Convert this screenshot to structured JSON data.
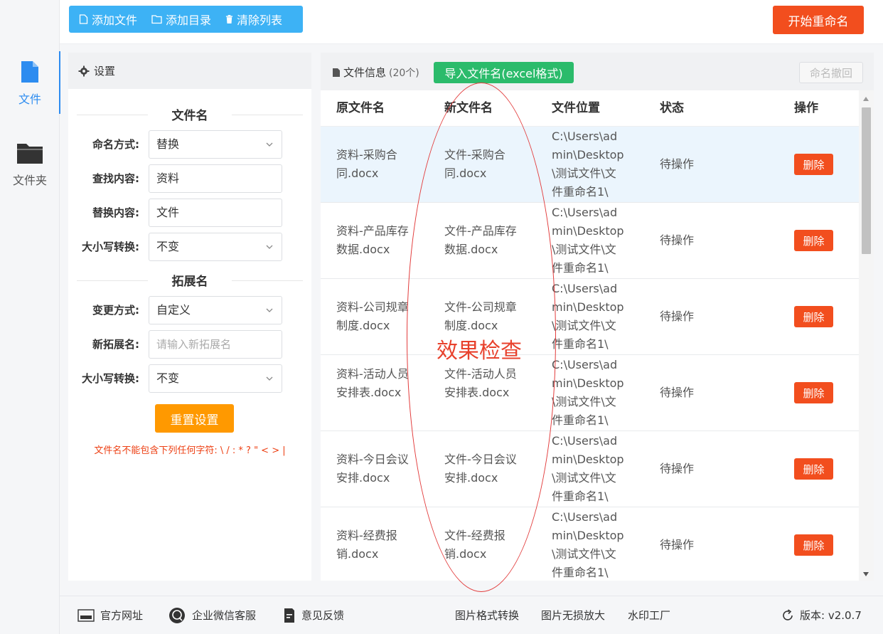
{
  "toolbar": {
    "add_file": "添加文件",
    "add_dir": "添加目录",
    "clear_list": "清除列表",
    "start": "开始重命名"
  },
  "rail": {
    "file": "文件",
    "folder": "文件夹"
  },
  "settings": {
    "title": "设置",
    "section_name": "文件名",
    "naming_label": "命名方式:",
    "naming_value": "替换",
    "find_label": "查找内容:",
    "find_value": "资料",
    "replace_label": "替换内容:",
    "replace_value": "文件",
    "case_label": "大小写转换:",
    "case_value": "不变",
    "section_ext": "拓展名",
    "change_label": "变更方式:",
    "change_value": "自定义",
    "newext_label": "新拓展名:",
    "newext_placeholder": "请输入新拓展名",
    "ext_case_label": "大小写转换:",
    "ext_case_value": "不变",
    "reset": "重置设置",
    "warning": "文件名不能包含下列任何字符: \\ / : * ? \" < > |"
  },
  "files": {
    "title": "文件信息",
    "count": "(20个)",
    "import": "导入文件名(excel格式)",
    "undo": "命名撤回",
    "columns": [
      "原文件名",
      "新文件名",
      "文件位置",
      "状态",
      "操作"
    ],
    "rows": [
      {
        "orig": "资料-采购合同.docx",
        "new": "文件-采购合同.docx",
        "path": "C:\\Users\\admin\\Desktop\\测试文件\\文件重命名1\\",
        "status": "待操作",
        "action": "删除"
      },
      {
        "orig": "资料-产品库存数据.docx",
        "new": "文件-产品库存数据.docx",
        "path": "C:\\Users\\admin\\Desktop\\测试文件\\文件重命名1\\",
        "status": "待操作",
        "action": "删除"
      },
      {
        "orig": "资料-公司规章制度.docx",
        "new": "文件-公司规章制度.docx",
        "path": "C:\\Users\\admin\\Desktop\\测试文件\\文件重命名1\\",
        "status": "待操作",
        "action": "删除"
      },
      {
        "orig": "资料-活动人员安排表.docx",
        "new": "文件-活动人员安排表.docx",
        "path": "C:\\Users\\admin\\Desktop\\测试文件\\文件重命名1\\",
        "status": "待操作",
        "action": "删除"
      },
      {
        "orig": "资料-今日会议安排.docx",
        "new": "文件-今日会议安排.docx",
        "path": "C:\\Users\\admin\\Desktop\\测试文件\\文件重命名1\\",
        "status": "待操作",
        "action": "删除"
      },
      {
        "orig": "资料-经费报销.docx",
        "new": "文件-经费报销.docx",
        "path": "C:\\Users\\admin\\Desktop\\测试文件\\文件重命名1\\",
        "status": "待操作",
        "action": "删除"
      }
    ]
  },
  "annotation": "效果检查",
  "footer": {
    "website": "官方网址",
    "wechat": "企业微信客服",
    "feedback": "意见反馈",
    "img_convert": "图片格式转换",
    "img_enlarge": "图片无损放大",
    "watermark": "水印工厂",
    "version": "版本: v2.0.7"
  },
  "colors": {
    "accent_blue": "#3db2f5",
    "primary_blue": "#2d8cf0",
    "danger": "#f24e1e",
    "warning_orange": "#ff9900",
    "success_green": "#2bbb6b",
    "row_highlight": "#ebf5fd"
  }
}
